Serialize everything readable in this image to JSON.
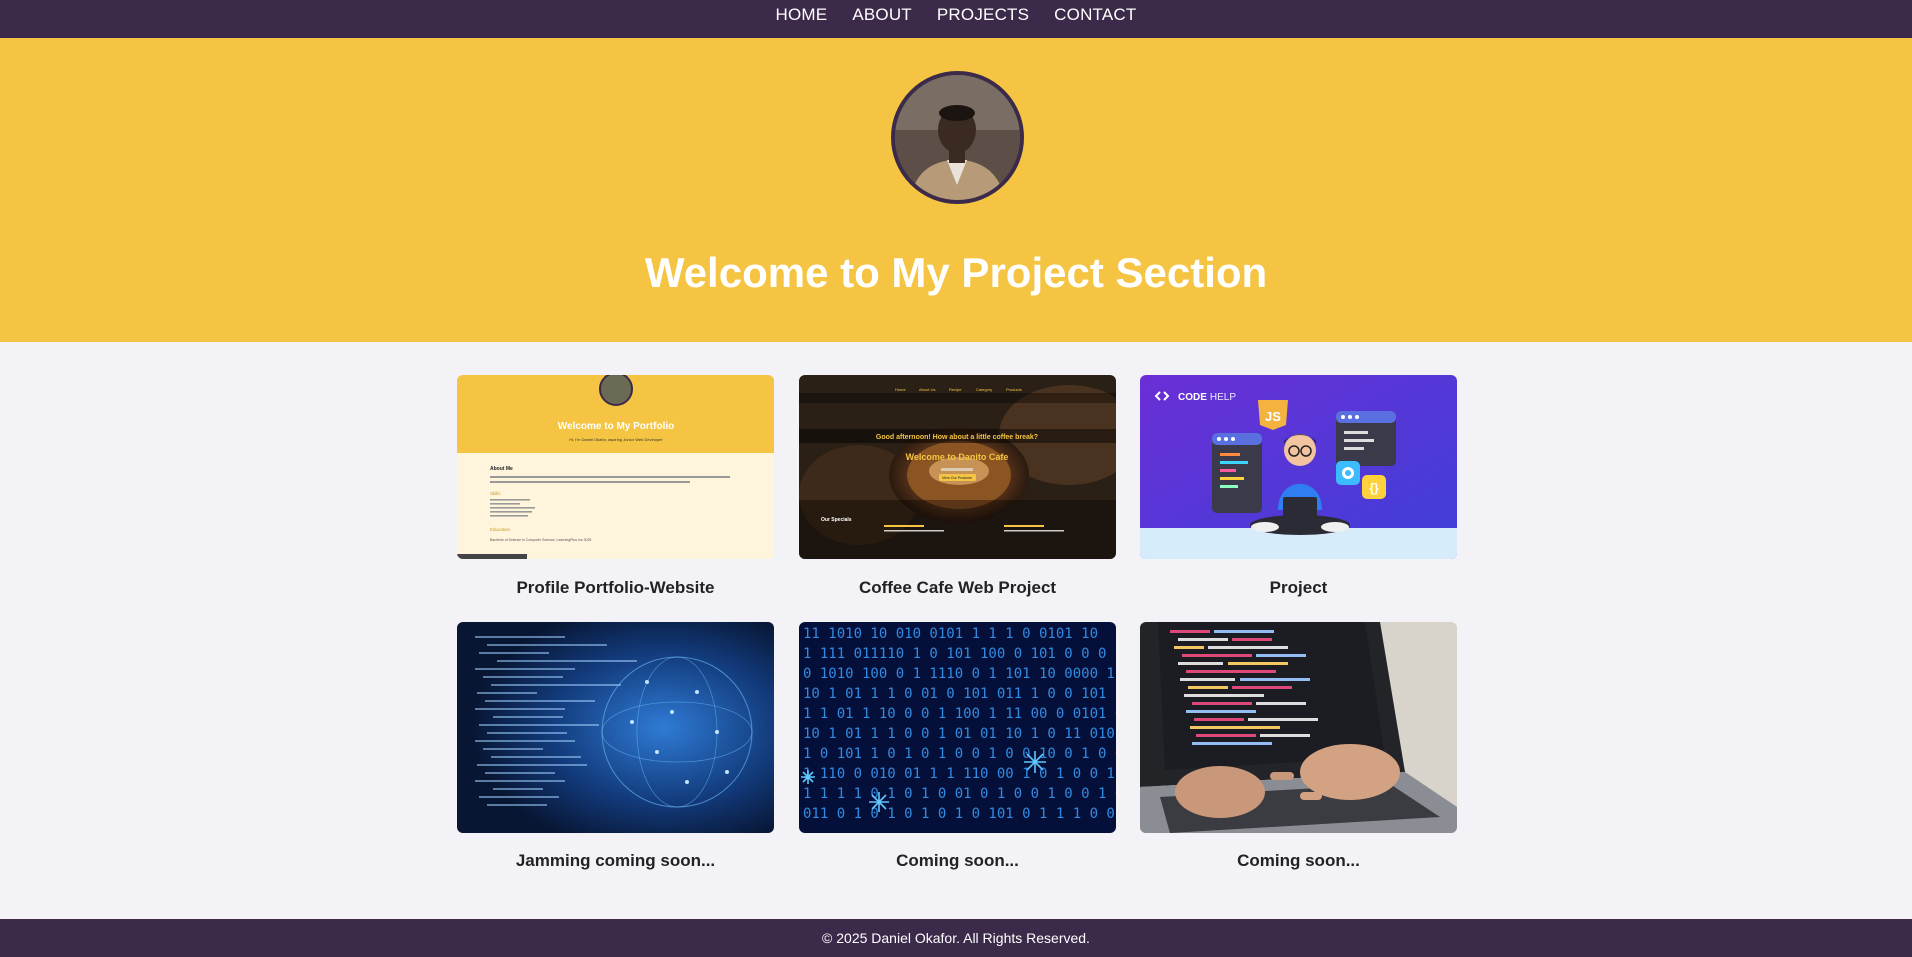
{
  "nav": {
    "items": [
      "HOME",
      "ABOUT",
      "PROJECTS",
      "CONTACT"
    ]
  },
  "hero": {
    "title": "Welcome to My Project Section"
  },
  "projects": [
    {
      "title": "Profile Portfolio-Website",
      "thumb": {
        "heading": "Welcome to My Portfolio",
        "tagline": "Hi, I'm Daniel Okafor, aspiring Junior Web Developer",
        "about": "About Me",
        "skills": "Skills",
        "education": "Education",
        "edu_text": "Bachelor of Science in Computer Science, LearningPlus Inc 2025"
      }
    },
    {
      "title": "Coffee Cafe Web Project",
      "thumb": {
        "nav": [
          "Home",
          "About Us",
          "Recipe",
          "Category",
          "Products"
        ],
        "greeting": "Good afternoon! How about a little coffee break?",
        "heading": "Welcome to Danito Cafe",
        "button": "View Our Products",
        "specials": "Our Specials"
      }
    },
    {
      "title": "Project",
      "thumb": {
        "brand_a": "CODE",
        "brand_b": "HELP",
        "badge": "JS"
      }
    },
    {
      "title": "Jamming coming soon..."
    },
    {
      "title": "Coming soon..."
    },
    {
      "title": "Coming soon..."
    }
  ],
  "footer": {
    "text": "© 2025 Daniel Okafor. All Rights Reserved."
  },
  "colors": {
    "nav_bg": "#3c2a4a",
    "hero_bg": "#f4c442",
    "page_bg": "#f3f3f7"
  }
}
